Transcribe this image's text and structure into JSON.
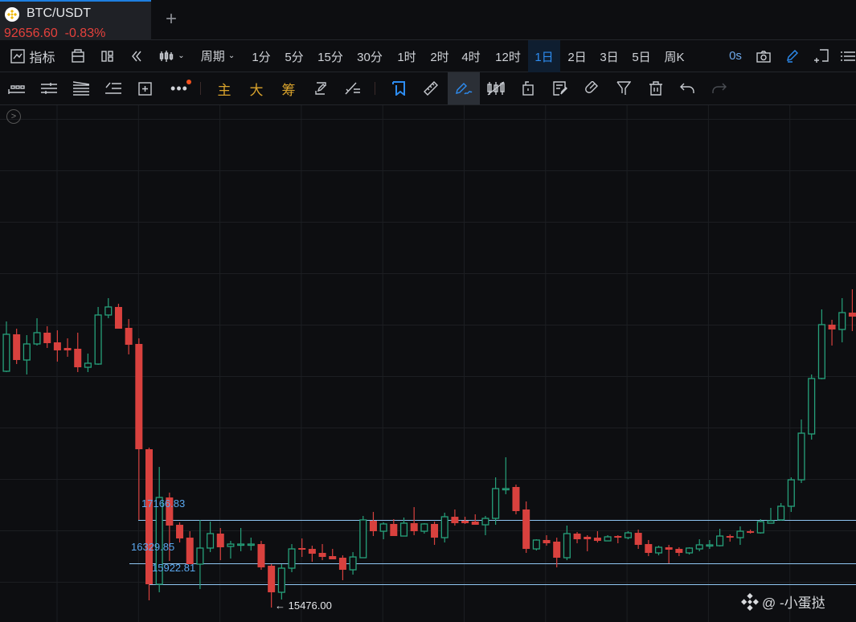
{
  "tab": {
    "symbol": "BTC/USDT",
    "price": "92656.60",
    "change": "-0.83%",
    "logo": "binance-logo",
    "add": "+"
  },
  "toolbar1": {
    "indicators": "指标",
    "period": "周期",
    "intervals": [
      "1分",
      "5分",
      "15分",
      "30分",
      "1时",
      "2时",
      "4时",
      "12时",
      "1日",
      "2日",
      "3日",
      "5日",
      "周K"
    ],
    "active_interval": "1日",
    "countdown": "0s"
  },
  "toolbar2": {
    "main": "主",
    "big": "大",
    "chips": "筹"
  },
  "colors": {
    "up": "#26a17b",
    "down": "#d9413e",
    "level": "#8fc6f2",
    "accent": "#2d8cf0",
    "gold": "#d9a32c"
  },
  "levels": [
    {
      "price": 17166.83,
      "label": "17166.83"
    },
    {
      "price": 16329.85,
      "label": "16329.85"
    },
    {
      "price": 15922.81,
      "label": "15922.81"
    }
  ],
  "low_marker": {
    "label": "← 15476.00",
    "price": 15476.0
  },
  "watermark": "@ -小蛋挞",
  "chart_data": {
    "type": "candlestick",
    "ylim": [
      15198,
      25164
    ],
    "grid": true,
    "candles": [
      [
        19368,
        20142,
        19290,
        20034
      ],
      [
        20034,
        20995,
        20018,
        20747
      ],
      [
        20747,
        20855,
        20173,
        20251
      ],
      [
        20251,
        20731,
        19972,
        20561
      ],
      [
        20561,
        21057,
        20530,
        20778
      ],
      [
        20778,
        20902,
        20483,
        20576
      ],
      [
        20592,
        20824,
        20220,
        20437
      ],
      [
        20483,
        20669,
        20313,
        20437
      ],
      [
        20468,
        20778,
        20018,
        20111
      ],
      [
        20111,
        20375,
        20018,
        20189
      ],
      [
        20173,
        21274,
        20158,
        21119
      ],
      [
        21119,
        21444,
        21057,
        21274
      ],
      [
        21274,
        21336,
        20855,
        20855
      ],
      [
        20871,
        21041,
        20359,
        20545
      ],
      [
        20561,
        20669,
        17167,
        18530
      ],
      [
        18530,
        18561,
        15616,
        15926
      ],
      [
        15926,
        18189,
        15771,
        17600
      ],
      [
        17600,
        17693,
        16376,
        17058
      ],
      [
        17073,
        17120,
        16732,
        16810
      ],
      [
        16825,
        16949,
        16314,
        16314
      ],
      [
        16314,
        17167,
        15833,
        16624
      ],
      [
        16624,
        17135,
        16546,
        16903
      ],
      [
        16903,
        17011,
        16391,
        16639
      ],
      [
        16655,
        16763,
        16422,
        16701
      ],
      [
        16686,
        17011,
        16562,
        16701
      ],
      [
        16686,
        16825,
        16577,
        16701
      ],
      [
        16701,
        16763,
        16205,
        16252
      ],
      [
        16283,
        16314,
        15476,
        15771
      ],
      [
        15771,
        16314,
        15632,
        16236
      ],
      [
        16236,
        16701,
        16159,
        16608
      ],
      [
        16624,
        16810,
        16453,
        16593
      ],
      [
        16608,
        16670,
        16360,
        16515
      ],
      [
        16531,
        16701,
        16391,
        16453
      ],
      [
        16469,
        16608,
        16407,
        16407
      ],
      [
        16438,
        16484,
        16004,
        16205
      ],
      [
        16205,
        16546,
        16112,
        16453
      ],
      [
        16438,
        17244,
        16438,
        17167
      ],
      [
        17151,
        17321,
        16856,
        16949
      ],
      [
        16949,
        17120,
        16794,
        17089
      ],
      [
        17089,
        17182,
        16856,
        16856
      ],
      [
        16856,
        17213,
        16856,
        17104
      ],
      [
        17104,
        17414,
        16872,
        16949
      ],
      [
        16949,
        17104,
        16903,
        17089
      ],
      [
        17089,
        17135,
        16686,
        16825
      ],
      [
        16825,
        17306,
        16732,
        17228
      ],
      [
        17228,
        17368,
        17058,
        17104
      ],
      [
        17151,
        17228,
        17089,
        17104
      ],
      [
        17135,
        17275,
        17073,
        17073
      ],
      [
        17073,
        17244,
        16872,
        17197
      ],
      [
        17197,
        17988,
        17073,
        17771
      ],
      [
        17755,
        18375,
        17662,
        17771
      ],
      [
        17802,
        17848,
        17275,
        17337
      ],
      [
        17368,
        17523,
        16531,
        16608
      ],
      [
        16608,
        16794,
        16577,
        16779
      ],
      [
        16779,
        16872,
        16670,
        16717
      ],
      [
        16748,
        16825,
        16252,
        16438
      ],
      [
        16438,
        17058,
        16391,
        16903
      ],
      [
        16903,
        16934,
        16717,
        16794
      ],
      [
        16841,
        16872,
        16562,
        16794
      ],
      [
        16825,
        16949,
        16732,
        16763
      ],
      [
        16763,
        16872,
        16763,
        16841
      ],
      [
        16856,
        16872,
        16717,
        16825
      ],
      [
        16825,
        16949,
        16794,
        16918
      ],
      [
        16918,
        16980,
        16608,
        16686
      ],
      [
        16701,
        16779,
        16469,
        16531
      ],
      [
        16531,
        16670,
        16484,
        16639
      ],
      [
        16639,
        16686,
        16329,
        16593
      ],
      [
        16608,
        16639,
        16469,
        16531
      ],
      [
        16531,
        16639,
        16500,
        16624
      ],
      [
        16608,
        16794,
        16562,
        16686
      ],
      [
        16670,
        16779,
        16608,
        16686
      ],
      [
        16670,
        16996,
        16655,
        16856
      ],
      [
        16856,
        16887,
        16748,
        16825
      ],
      [
        16825,
        17042,
        16686,
        16949
      ],
      [
        16949,
        16980,
        16903,
        16918
      ],
      [
        16918,
        17182,
        16903,
        17135
      ],
      [
        17104,
        17399,
        17104,
        17151
      ],
      [
        17167,
        17492,
        17151,
        17430
      ],
      [
        17430,
        17988,
        17321,
        17941
      ],
      [
        17941,
        19104,
        17879,
        18840
      ],
      [
        18825,
        19972,
        18716,
        19894
      ],
      [
        19894,
        21227,
        19879,
        20933
      ],
      [
        20933,
        21026,
        20530,
        20840
      ],
      [
        20840,
        21444,
        20592,
        21165
      ],
      [
        21165,
        21615,
        20809,
        21088
      ]
    ]
  }
}
